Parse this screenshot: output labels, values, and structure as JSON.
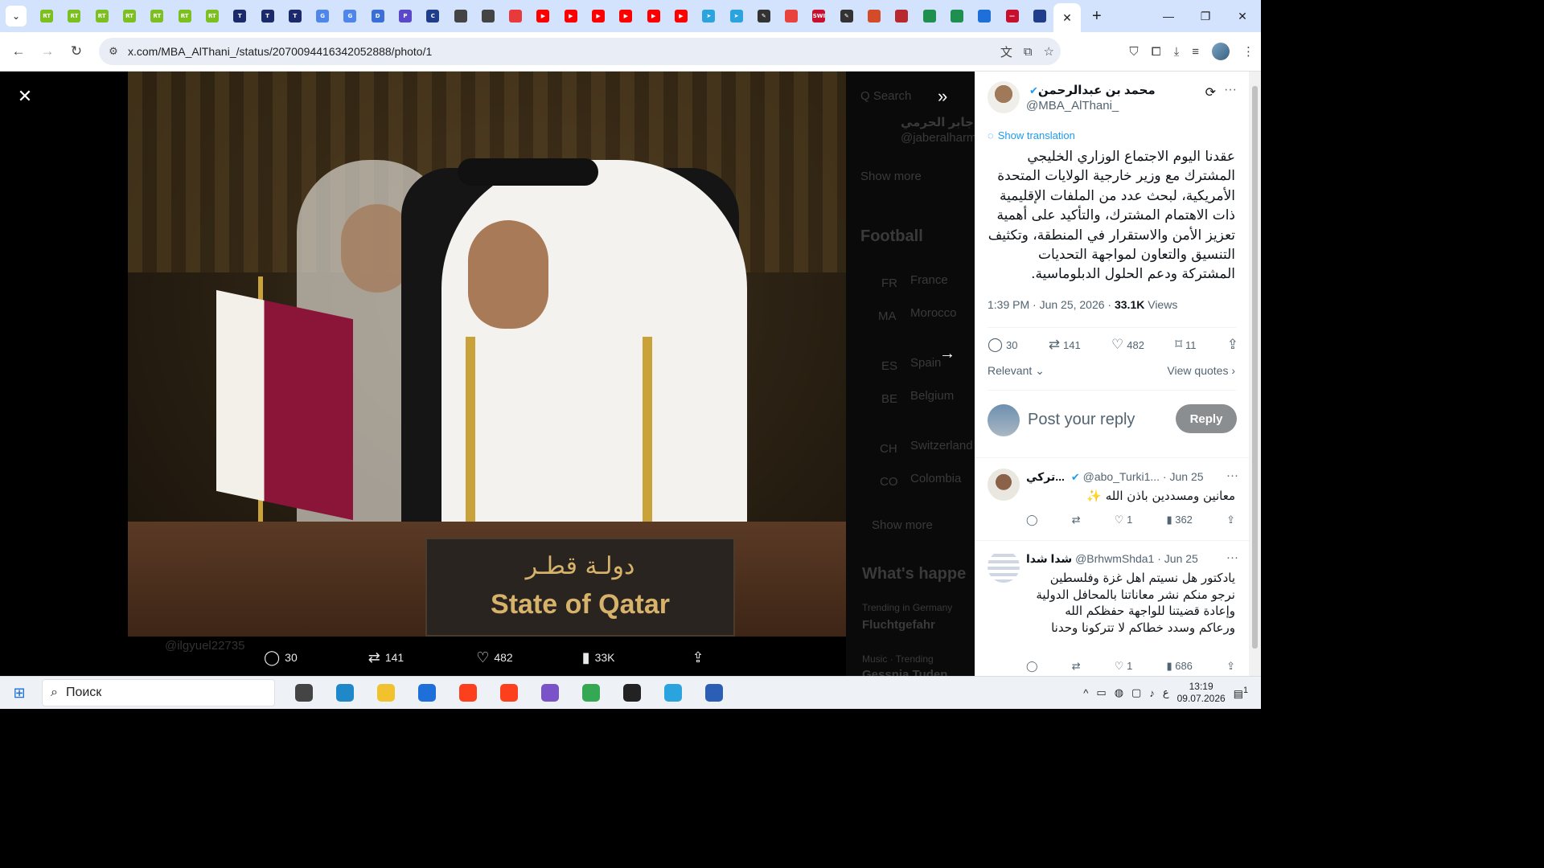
{
  "browser": {
    "url": "x.com/MBA_AlThani_/status/2070094416342052888/photo/1",
    "tabs": [
      {
        "icon": "rt-icon",
        "label": "RT",
        "color": "#7bc01e"
      },
      {
        "icon": "rt-icon",
        "label": "RT",
        "color": "#7bc01e"
      },
      {
        "icon": "rt-icon",
        "label": "RT",
        "color": "#7bc01e"
      },
      {
        "icon": "rt-icon",
        "label": "RT",
        "color": "#7bc01e"
      },
      {
        "icon": "rt-icon",
        "label": "RT",
        "color": "#7bc01e"
      },
      {
        "icon": "rt-icon",
        "label": "RT",
        "color": "#7bc01e"
      },
      {
        "icon": "rt-icon",
        "label": "RT",
        "color": "#7bc01e"
      },
      {
        "icon": "t-icon",
        "label": "T",
        "color": "#1a2a6c"
      },
      {
        "icon": "t-icon",
        "label": "T",
        "color": "#1a2a6c"
      },
      {
        "icon": "t-icon",
        "label": "T",
        "color": "#1a2a6c"
      },
      {
        "icon": "translate-icon",
        "label": "G",
        "color": "#4f86ec"
      },
      {
        "icon": "translate-icon",
        "label": "G",
        "color": "#4f86ec"
      },
      {
        "icon": "deepl-icon",
        "label": "D",
        "color": "#3a6fd8"
      },
      {
        "icon": "perplexity-icon",
        "label": "P",
        "color": "#5b47c9"
      },
      {
        "icon": "moon-icon",
        "label": "C",
        "color": "#1f3d8a"
      },
      {
        "icon": "globe-icon",
        "label": "",
        "color": "#444444"
      },
      {
        "icon": "globe-icon",
        "label": "",
        "color": "#444444"
      },
      {
        "icon": "swirl-icon",
        "label": "",
        "color": "#e8393b"
      },
      {
        "icon": "youtube-icon",
        "label": "▶",
        "color": "#ff0000"
      },
      {
        "icon": "youtube-icon",
        "label": "▶",
        "color": "#ff0000"
      },
      {
        "icon": "youtube-icon",
        "label": "▶",
        "color": "#ff0000"
      },
      {
        "icon": "youtube-icon",
        "label": "▶",
        "color": "#ff0000"
      },
      {
        "icon": "youtube-icon",
        "label": "▶",
        "color": "#ff0000"
      },
      {
        "icon": "youtube-icon",
        "label": "▶",
        "color": "#ff0000"
      },
      {
        "icon": "telegram-icon",
        "label": "➤",
        "color": "#2aa3df"
      },
      {
        "icon": "telegram-icon",
        "label": "➤",
        "color": "#2aa3df"
      },
      {
        "icon": "quill-icon",
        "label": "✎",
        "color": "#333333"
      },
      {
        "icon": "ring-icon",
        "label": "",
        "color": "#e8433d"
      },
      {
        "icon": "swi-icon",
        "label": "SWI",
        "color": "#c8102e"
      },
      {
        "icon": "quill-icon",
        "label": "✎",
        "color": "#333333"
      },
      {
        "icon": "tool-icon",
        "label": "",
        "color": "#d44b2a"
      },
      {
        "icon": "mail-icon",
        "label": "",
        "color": "#b8292f"
      },
      {
        "icon": "diamond-icon",
        "label": "",
        "color": "#1e8f4e"
      },
      {
        "icon": "diamond-icon",
        "label": "",
        "color": "#1e8f4e"
      },
      {
        "icon": "video-icon",
        "label": "",
        "color": "#1e6fd9"
      },
      {
        "icon": "dash-icon",
        "label": "—",
        "color": "#c8102e"
      },
      {
        "icon": "moon-icon",
        "label": "",
        "color": "#1f3d8a"
      }
    ]
  },
  "viewer": {
    "photo_texts": {
      "arabic": "دولـة قطـر",
      "english": "State of Qatar"
    },
    "bar": {
      "replies": "30",
      "reposts": "141",
      "likes": "482",
      "views": "33K"
    },
    "ghost_sidebar": [
      "Q Search",
      "جابر الحرمي",
      "@jaberalharmi",
      "Show more",
      "Football",
      "FR",
      "France",
      "MA",
      "Morocco",
      "ES",
      "Spain",
      "BE",
      "Belgium",
      "CH",
      "Switzerland",
      "CO",
      "Colombia",
      "Show more",
      "What's happe",
      "Trending in Germany",
      "Fluchtgefahr",
      "Music · Trending",
      "Gessnia Tuden",
      "@ilgyuel22735"
    ]
  },
  "tweet": {
    "author_name": "محمد بن عبدالرحمن",
    "handle": "@MBA_AlThani_",
    "show_translation": "Show translation",
    "text": "عقدنا اليوم الاجتماع الوزاري الخليجي المشترك مع وزير خارجية الولايات المتحدة الأمريكية، لبحث عدد من الملفات الإقليمية ذات الاهتمام المشترك، والتأكيد على أهمية تعزيز الأمن والاستقرار في المنطقة، وتكثيف التنسيق والتعاون لمواجهة التحديات المشتركة ودعم الحلول الدبلوماسية.",
    "time": "1:39 PM · Jun 25, 2026 · ",
    "views_count": "33.1K",
    "views_label": " Views",
    "stats": {
      "replies": "30",
      "reposts": "141",
      "likes": "482",
      "bookmarks": "11"
    },
    "sort_label": "Relevant",
    "view_quotes": "View quotes",
    "reply_placeholder": "Post your reply",
    "reply_button": "Reply"
  },
  "replies": [
    {
      "name": "تركي...",
      "handle": "@abo_Turki1...",
      "date": " · Jun 25",
      "text": "معانين ومسددين باذن الله ✨",
      "replies": "",
      "reposts": "",
      "likes": "1",
      "views": "362"
    },
    {
      "name": "شدا شدا",
      "handle": "@BrhwmShda1",
      "date": " · Jun 25",
      "text": "يادكتور هل نسيتم اهل غزة وفلسطين نرجو منكم نشر معاناتنا بالمحافل الدولية وإعادة قضيتنا للواجهة حفظكم الله ورعاكم وسدد خطاكم لا تتركونا وحدنا",
      "replies": "",
      "reposts": "",
      "likes": "1",
      "views": "686"
    }
  ],
  "taskbar": {
    "search_placeholder": "Поиск",
    "time": "13:19",
    "date": "09.07.2026",
    "lang": "ع",
    "notif_count": "1",
    "apps": [
      {
        "icon": "task-view-icon",
        "color": "#444444"
      },
      {
        "icon": "edge-icon",
        "color": "#1e88c8"
      },
      {
        "icon": "explorer-icon",
        "color": "#f2c12e"
      },
      {
        "icon": "outlook-icon",
        "color": "#1e6fd9"
      },
      {
        "icon": "yandex-icon",
        "color": "#fc3f1d"
      },
      {
        "icon": "yandex-browser-icon",
        "color": "#fc3f1d"
      },
      {
        "icon": "m365-icon",
        "color": "#7a53c9"
      },
      {
        "icon": "chrome-icon",
        "color": "#34a853"
      },
      {
        "icon": "h-app-icon",
        "color": "#222222"
      },
      {
        "icon": "telegram-icon",
        "color": "#2aa3df"
      },
      {
        "icon": "word-icon",
        "color": "#2b5fb6"
      }
    ]
  }
}
